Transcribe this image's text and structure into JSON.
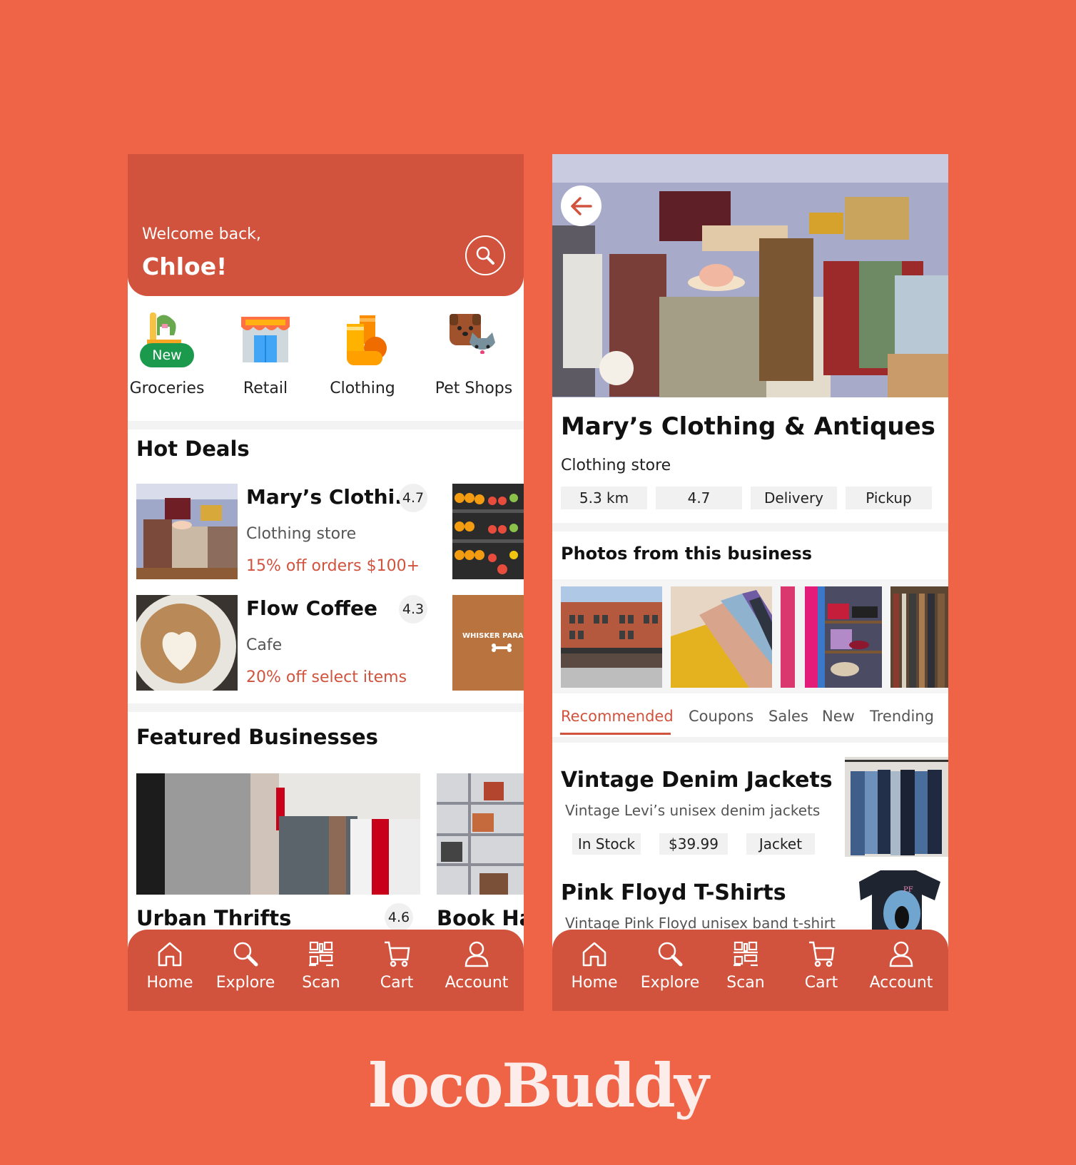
{
  "brand": {
    "name": "locoBuddy"
  },
  "colors": {
    "background": "#EF6347",
    "primary": "#D1533D",
    "new_badge": "#1B9A4E"
  },
  "home": {
    "greeting": "Welcome back,",
    "username": "Chloe!",
    "search_icon": "search-icon",
    "categories": [
      {
        "label": "Groceries",
        "icon": "groceries-icon",
        "badge": "New"
      },
      {
        "label": "Retail",
        "icon": "storefront-icon"
      },
      {
        "label": "Clothing",
        "icon": "socks-icon"
      },
      {
        "label": "Pet Shops",
        "icon": "dog-cat-icon"
      }
    ],
    "hot_deals": {
      "title": "Hot Deals",
      "items": [
        {
          "name": "Mary’s Clothi...",
          "type": "Clothing store",
          "offer": "15% off orders $100+",
          "rating": "4.7"
        },
        {
          "name": "Flow Coffee",
          "type": "Cafe",
          "offer": "20% off select items",
          "rating": "4.3"
        }
      ],
      "side_items": [
        {
          "label": ""
        },
        {
          "label": "WHISKER PARA"
        }
      ]
    },
    "featured": {
      "title": "Featured Businesses",
      "items": [
        {
          "name": "Urban Thrifts",
          "rating": "4.6"
        },
        {
          "name": "Book Hav"
        }
      ]
    }
  },
  "nav": [
    {
      "label": "Home",
      "icon": "home-icon"
    },
    {
      "label": "Explore",
      "icon": "search-icon"
    },
    {
      "label": "Scan",
      "icon": "qr-code-icon"
    },
    {
      "label": "Cart",
      "icon": "cart-icon"
    },
    {
      "label": "Account",
      "icon": "user-icon"
    }
  ],
  "business": {
    "name": "Mary’s Clothing & Antiques",
    "type": "Clothing store",
    "chips": [
      "5.3 km",
      "4.7",
      "Delivery",
      "Pickup"
    ],
    "photos_title": "Photos from this business",
    "tabs": [
      "Recommended",
      "Coupons",
      "Sales",
      "New",
      "Trending"
    ],
    "active_tab": "Recommended",
    "products": [
      {
        "name": "Vintage Denim Jackets",
        "description": "Vintage Levi’s unisex denim jackets",
        "tags": [
          "In Stock",
          "$39.99",
          "Jacket"
        ]
      },
      {
        "name": "Pink Floyd T-Shirts",
        "description": "Vintage Pink Floyd unisex band t-shirt"
      }
    ]
  }
}
